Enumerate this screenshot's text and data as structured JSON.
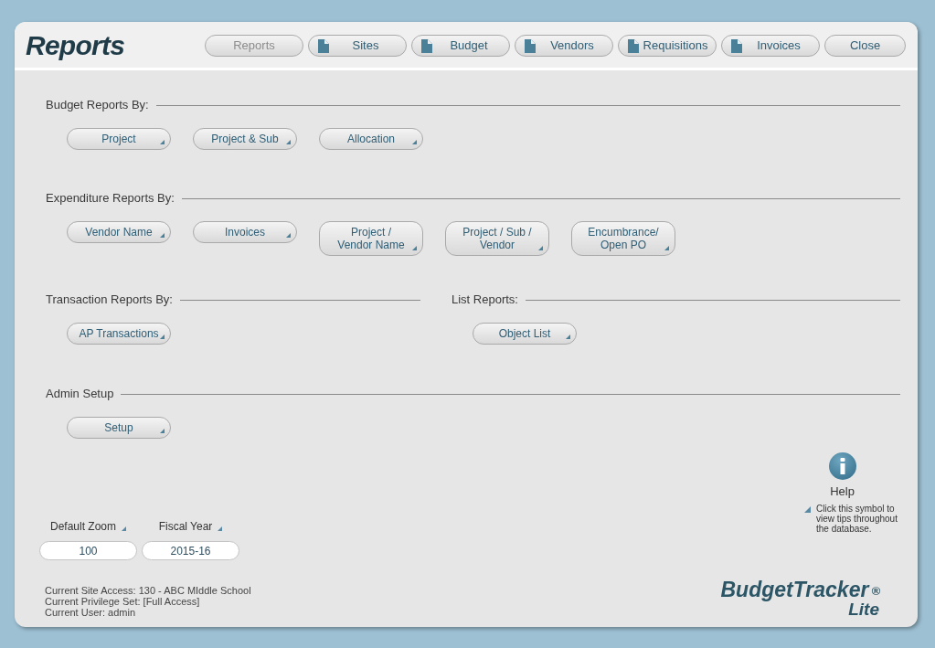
{
  "header": {
    "title": "Reports"
  },
  "nav": [
    {
      "kind": "plain",
      "label": "Reports",
      "disabled": true
    },
    {
      "kind": "page",
      "label": "Sites",
      "disabled": false
    },
    {
      "kind": "page",
      "label": "Budget",
      "disabled": false
    },
    {
      "kind": "page",
      "label": "Vendors",
      "disabled": false
    },
    {
      "kind": "page",
      "label": "Requisitions",
      "disabled": false
    },
    {
      "kind": "page",
      "label": "Invoices",
      "disabled": false
    },
    {
      "kind": "plain",
      "label": "Close",
      "disabled": false
    }
  ],
  "sections": [
    {
      "columns": [
        {
          "heading": "Budget Reports By:",
          "buttons": [
            "Project",
            "Project & Sub",
            "Allocation"
          ]
        }
      ]
    },
    {
      "columns": [
        {
          "heading": "Expenditure Reports By:",
          "buttons": [
            "Vendor Name",
            "Invoices",
            "Project /\nVendor Name",
            "Project / Sub /\nVendor",
            "Encumbrance/\nOpen PO"
          ]
        }
      ]
    },
    {
      "columns": [
        {
          "heading": "Transaction Reports By:",
          "buttons": [
            "AP Transactions"
          ]
        },
        {
          "heading": "List Reports:",
          "buttons": [
            "Object List"
          ]
        }
      ]
    },
    {
      "columns": [
        {
          "heading": "Admin Setup",
          "buttons": [
            "Setup"
          ]
        }
      ]
    }
  ],
  "settings": [
    {
      "label": "Default Zoom",
      "value": "100"
    },
    {
      "label": "Fiscal Year",
      "value": "2015-16"
    }
  ],
  "status_lines": [
    "Current Site Access: 130 - ABC MIddle School",
    "Current Privilege Set: [Full Access]",
    "Current User: admin"
  ],
  "help": {
    "label": "Help",
    "tip": "Click this symbol to view tips throughout the database."
  },
  "logo": {
    "name": "BudgetTracker",
    "mark": "®",
    "edition": "Lite"
  }
}
